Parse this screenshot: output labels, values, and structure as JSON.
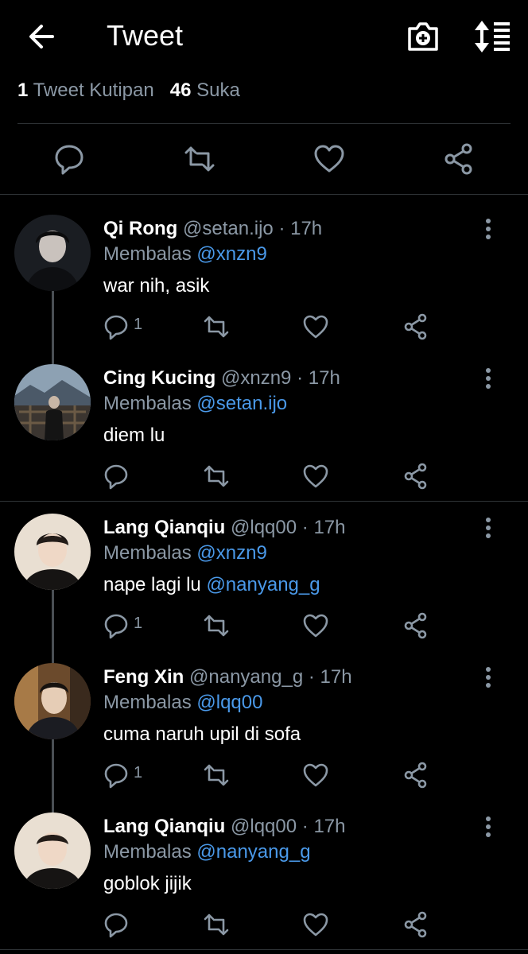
{
  "header": {
    "title": "Tweet",
    "back_icon": "back-arrow-icon",
    "camera_icon": "camera-plus-icon",
    "sort_icon": "sort-icon"
  },
  "stats": {
    "quotes_count": "1",
    "quotes_label": "Tweet Kutipan",
    "likes_count": "46",
    "likes_label": "Suka"
  },
  "replies": [
    {
      "name": "Qi Rong",
      "handle": "@setan.ijo",
      "time": "17h",
      "replying_label": "Membalas",
      "replying_to": "@xnzn9",
      "text": "war nih, asik",
      "reply_count": "1"
    },
    {
      "name": "Cing Kucing",
      "handle": "@xnzn9",
      "time": "17h",
      "replying_label": "Membalas",
      "replying_to": "@setan.ijo",
      "text": "diem lu",
      "reply_count": ""
    },
    {
      "name": "Lang Qianqiu",
      "handle": "@lqq00",
      "time": "17h",
      "replying_label": "Membalas",
      "replying_to": "@xnzn9",
      "text": "nape lagi lu ",
      "mention": "@nanyang_g",
      "reply_count": "1"
    },
    {
      "name": "Feng Xin",
      "handle": "@nanyang_g",
      "time": "17h",
      "replying_label": "Membalas",
      "replying_to": "@lqq00",
      "text": "cuma naruh upil di sofa",
      "reply_count": "1"
    },
    {
      "name": "Lang Qianqiu",
      "handle": "@lqq00",
      "time": "17h",
      "replying_label": "Membalas",
      "replying_to": "@nanyang_g",
      "text": "goblok jijik",
      "reply_count": ""
    }
  ],
  "sep": "·",
  "colors": {
    "background": "#000000",
    "link": "#4a99e9",
    "secondary_text": "#8b98a5"
  }
}
